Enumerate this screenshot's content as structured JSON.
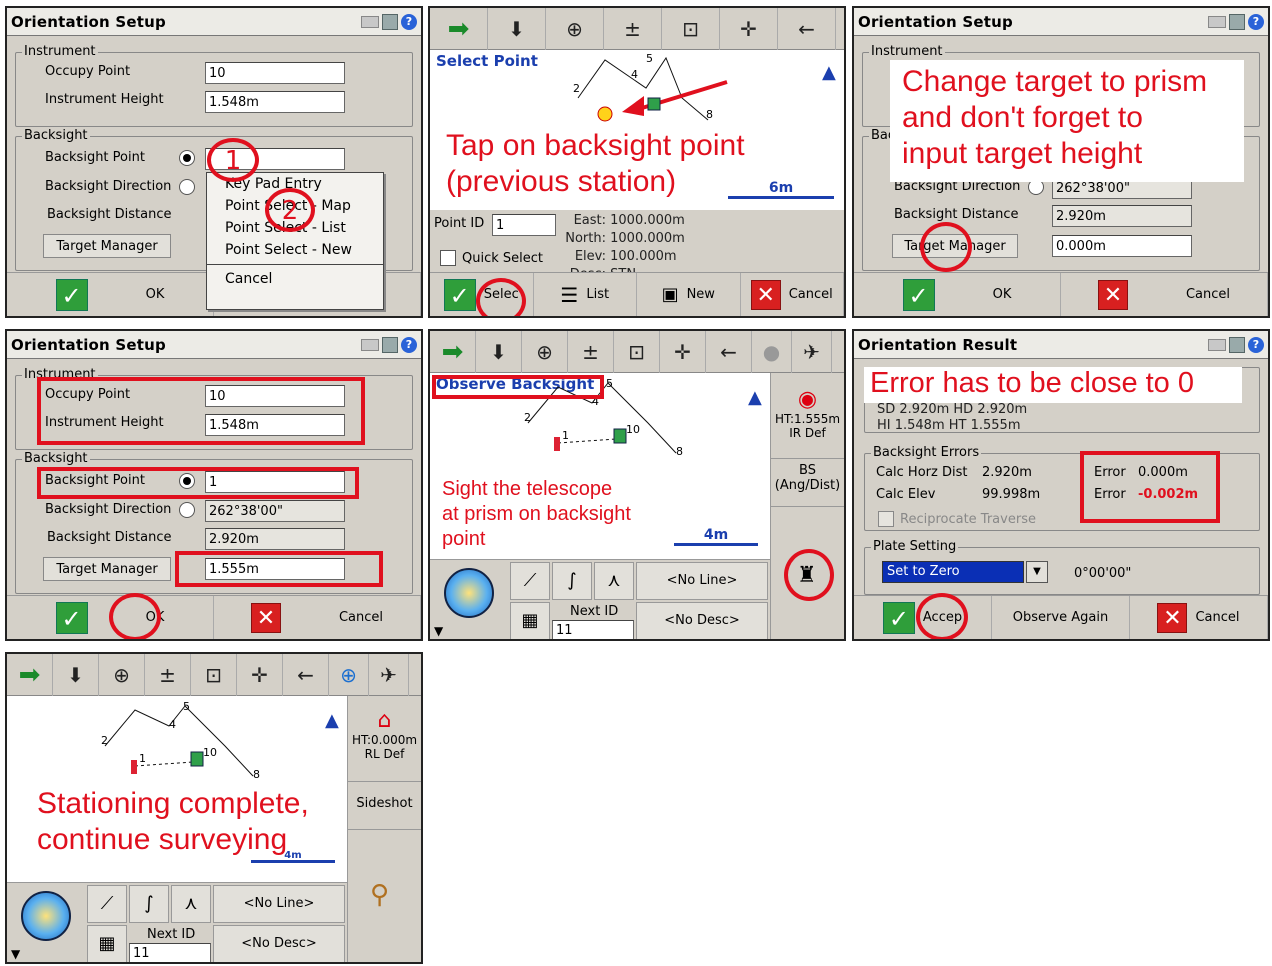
{
  "p1": {
    "title": "Orientation Setup",
    "instrument_group": "Instrument",
    "occupy_point_label": "Occupy Point",
    "occupy_point_value": "10",
    "instrument_height_label": "Instrument Height",
    "instrument_height_value": "1.548m",
    "backsight_group": "Backsight",
    "backsight_point_label": "Backsight Point",
    "backsight_direction_label": "Backsight Direction",
    "backsight_distance_label": "Backsight Distance",
    "target_manager": "Target Manager",
    "ok": "OK",
    "menu": [
      "Key Pad Entry",
      "Point Select - Map",
      "Point Select - List",
      "Point Select - New",
      "Cancel"
    ],
    "marker1": "1",
    "marker2": "2"
  },
  "p2": {
    "toolbar": [
      "➡",
      "⬇",
      "⊕",
      "±",
      "⊡",
      "✛",
      "←"
    ],
    "map_title": "Select Point",
    "annotation": "Tap on backsight point (previous station)",
    "annotation_l1": "Tap on backsight point",
    "annotation_l2": "(previous station)",
    "scale": "6m",
    "point_id_label": "Point ID",
    "point_id_value": "1",
    "east_label": "East:",
    "east_value": "1000.000m",
    "north_label": "North:",
    "north_value": "1000.000m",
    "elev_label": "Elev:",
    "elev_value": "100.000m",
    "desc_label": "Desc:",
    "desc_value": "STN",
    "quick_select": "Quick Select",
    "select": "Selec",
    "list": "List",
    "new": "New",
    "cancel": "Cancel",
    "point_labels": [
      "2",
      "4",
      "5",
      "8"
    ]
  },
  "p3": {
    "title": "Orientation Setup",
    "instrument_group": "Instrument",
    "annotation_l1": "Change target to prism",
    "annotation_l2": "and don't forget to",
    "annotation_l3": "input target height",
    "bac_label": "Bac",
    "backsight_direction_label": "Backsight Direction",
    "backsight_direction_value": "262°38'00\"",
    "backsight_distance_label": "Backsight Distance",
    "backsight_distance_value": "2.920m",
    "target_manager": "Target Manager",
    "target_height_value": "0.000m",
    "ok": "OK",
    "cancel": "Cancel"
  },
  "p4": {
    "title": "Orientation Setup",
    "instrument_group": "Instrument",
    "occupy_point_label": "Occupy Point",
    "occupy_point_value": "10",
    "instrument_height_label": "Instrument Height",
    "instrument_height_value": "1.548m",
    "backsight_group": "Backsight",
    "backsight_point_label": "Backsight Point",
    "backsight_point_value": "1",
    "backsight_direction_label": "Backsight Direction",
    "backsight_direction_value": "262°38'00\"",
    "backsight_distance_label": "Backsight Distance",
    "backsight_distance_value": "2.920m",
    "target_manager": "Target Manager",
    "target_height_value": "1.555m",
    "ok": "OK",
    "cancel": "Cancel"
  },
  "p5": {
    "map_title": "Observe Backsight",
    "annotation_l1": "Sight the telescope",
    "annotation_l2": "at prism on backsight",
    "annotation_l3": "point",
    "scale": "4m",
    "side_ht": "HT:1.555m",
    "side_ir": "IR Def",
    "side_bs": "BS",
    "side_angdist": "(Ang/Dist)",
    "no_line": "<No Line>",
    "next_id_label": "Next ID",
    "next_id_value": "11",
    "no_desc": "<No Desc>",
    "point_labels": [
      "2",
      "4",
      "5",
      "8",
      "1",
      "10"
    ]
  },
  "p6": {
    "title": "Orientation Result",
    "annotation": "Error has to be close to 0",
    "sd_line": "SD 2.920m  HD 2.920m",
    "hi_line": "HI 1.548m  HT 1.555m",
    "errors_group": "Backsight Errors",
    "calc_horz_label": "Calc Horz Dist",
    "calc_horz_value": "2.920m",
    "calc_elev_label": "Calc Elev",
    "calc_elev_value": "99.998m",
    "error_label": "Error",
    "error1_value": "0.000m",
    "error2_value": "-0.002m",
    "reciprocate": "Reciprocate Traverse",
    "plate_group": "Plate Setting",
    "plate_select": "Set to Zero",
    "plate_value": "0°00'00\"",
    "accept": "Accep",
    "observe_again": "Observe Again",
    "cancel": "Cancel"
  },
  "p7": {
    "annotation_l1": "Stationing complete,",
    "annotation_l2": "continue surveying",
    "scale": "4m",
    "side_ht": "HT:0.000m",
    "side_rl": "RL Def",
    "sideshot": "Sideshot",
    "no_line": "<No Line>",
    "next_id_label": "Next ID",
    "next_id_value": "11",
    "no_desc": "<No Desc>",
    "point_labels": [
      "2",
      "4",
      "5",
      "8",
      "1",
      "10"
    ]
  },
  "colors": {
    "accent_red": "#e0101e",
    "map_blue": "#1b3fae",
    "ok_green": "#2f9e3a"
  }
}
